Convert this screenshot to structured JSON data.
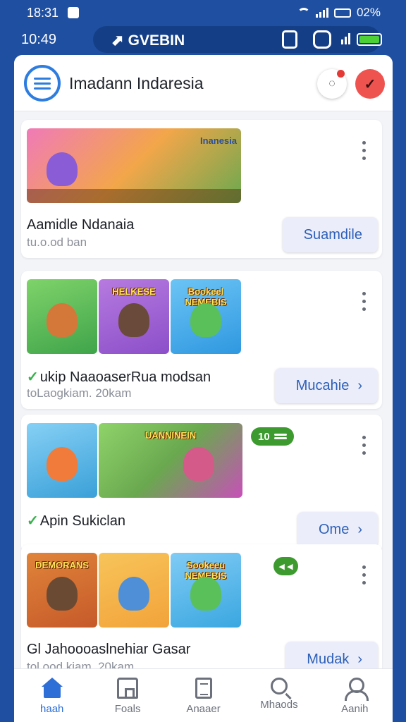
{
  "status": {
    "time": "18:31",
    "battery": "02%"
  },
  "topbar": {
    "time": "10:49",
    "brand": "GVEBIN"
  },
  "header": {
    "title": "Imadann Indaresia"
  },
  "cards": [
    {
      "thumbs": [
        {
          "label": "Inanesia",
          "bg": "#f3a64a",
          "mascot": "#8a5cd6"
        }
      ],
      "title": "Aamidle Ndanaia",
      "subtitle": "tu.o.od ban",
      "action": "Suamdile",
      "chevron": ""
    },
    {
      "thumbs": [
        {
          "label": "",
          "bg": "#3fa44a",
          "mascot": "#d4783a"
        },
        {
          "label": "HELKESE",
          "bg": "#8c4fc9",
          "mascot": "#6a4a3a"
        },
        {
          "label": "Bookeel NEMEBIS",
          "bg": "#2f98e0",
          "mascot": "#5ac05a"
        }
      ],
      "title": "ukip NaaoaserRua modsan",
      "subtitle": "toLaogkiam. 20kam",
      "action": "Mucahie",
      "chevron": "›"
    },
    {
      "thumbs": [
        {
          "label": "",
          "bg": "#3aa0d8",
          "mascot": "#f07b3a"
        },
        {
          "label": "UANNINEIN",
          "bg": "#c750b8",
          "mascot": "#d45a8a"
        }
      ],
      "badge": "10",
      "title": "Apin Sukiclan",
      "subtitle": "",
      "action": "Ome",
      "chevron": "›"
    },
    {
      "thumbs": [
        {
          "label": "DEMORANS",
          "bg": "#c65a2a",
          "mascot": "#6b4a33"
        },
        {
          "label": "",
          "bg": "#f2a33a",
          "mascot": "#4f8fd8"
        },
        {
          "label": "Sookeeu NEMEBIS",
          "bg": "#3aa7e0",
          "mascot": "#5ac05a"
        }
      ],
      "badge": "",
      "title": "Gl Jahoooaslnehiar Gasar",
      "subtitle": "tol ood kiam. 20kam",
      "action": "Mudak",
      "chevron": "›"
    }
  ],
  "tabs": [
    {
      "label": "haah",
      "icon": "home-icon",
      "active": true
    },
    {
      "label": "Foals",
      "icon": "feed-icon",
      "active": false
    },
    {
      "label": "Anaaer",
      "icon": "document-icon",
      "active": false
    },
    {
      "label": "Mhaods",
      "icon": "search-icon",
      "active": false
    },
    {
      "label": "Aanih",
      "icon": "user-icon",
      "active": false
    }
  ],
  "colors": {
    "accent": "#2d6fd6",
    "statusbar": "#1f4fa0",
    "badge": "#3d9a2f",
    "notification": "#e53935"
  }
}
